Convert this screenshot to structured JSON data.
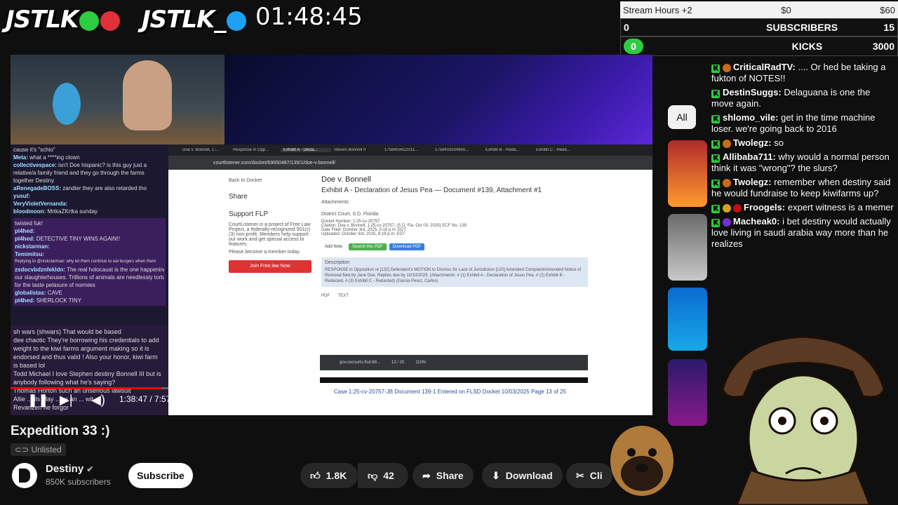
{
  "overlay": {
    "logo1": "JSTLK",
    "logo2": "JSTLK_",
    "timer": "01:48:45"
  },
  "goals": {
    "hours_label": "Stream Hours +2",
    "hours_min": "$0",
    "hours_max": "$60",
    "subs_current": "0",
    "subs_label": "SUBSCRIBERS",
    "subs_target": "15",
    "kicks_current": "0",
    "kicks_label": "KICKS",
    "kicks_target": "3000"
  },
  "embedded_chat": {
    "lines": [
      {
        "user": "",
        "text": "cause it's \"schio\""
      },
      {
        "user": "Meta:",
        "text": "what a ****ing clown"
      },
      {
        "user": "collectivespace:",
        "text": "isn't Doe hispanic? is this guy just a"
      },
      {
        "user": "",
        "text": "relative/a family friend and they go through the farms"
      },
      {
        "user": "",
        "text": "together Destiny"
      },
      {
        "user": "aRenegadeBOSS:",
        "text": "zandier they are also retarded tho"
      },
      {
        "user": "yusuf:",
        "text": ""
      },
      {
        "user": "VeryVioletVernanda:",
        "text": ""
      },
      {
        "user": "bloodmoon:",
        "text": "MrtkaZKrtka sunday"
      },
      {
        "user": "",
        "text": "twisted fuk!"
      },
      {
        "user": "pl4hed:",
        "text": ""
      },
      {
        "user": "pl4hed:",
        "text": "DETECTIVE TINY WINS AGAIN!!"
      },
      {
        "user": "nickstarman:",
        "text": ""
      },
      {
        "user": "Temimitsu:",
        "text": ""
      },
      {
        "user": "",
        "text": "Replying to @nickstarman: why let them continue to eat burgers when them"
      },
      {
        "user": "zsdocvbdznfekldn:",
        "text": "The real holocaust is the one happening in"
      },
      {
        "user": "",
        "text": "our slaughterhouses. Trillions of animals are needlessly torture"
      },
      {
        "user": "",
        "text": "for the taste pelasure of normies"
      },
      {
        "user": "globalistas:",
        "text": "CAVE"
      },
      {
        "user": "pl4hed:",
        "text": "SHERLOCK TINY"
      }
    ],
    "bottom": [
      "sh wars (shwars) That would be based",
      "dee chaotic They're borrowing his credentials to add",
      "weight to the kiwi farms argument making so it is",
      "endorsed and thus valid ! Also your honor, kiwi farm",
      "is based lol",
      "Todd Michael I love Stephen destiny Bonnell III but is",
      "anybody following what he's saying?",
      "Thomas Horton such an unserious lawsuit",
      "Allie ... ils May ... re an ... wit",
      "Revanzen he forgor"
    ]
  },
  "browser": {
    "tabs": [
      "Doe v. Bonnell, 1:...",
      "Response in Opp...",
      "Exhibit A - Decla...",
      "Steven Bonnell II",
      "1758403422011...",
      "1758403504850...",
      "Exhibit B - Reda...",
      "Exhibit C - Reda..."
    ],
    "url": "courtlistener.com/docket/69650487/139/1/doe-v-bonnell/",
    "back": "Back to Docket",
    "share": "Share",
    "support": "Support FLP",
    "support_text": "CourtListener is a project of Free Law Project, a federally-recognized 501(c)(3) non-profit. Members help support our work and get special access to features.",
    "please": "Please become a member today.",
    "join": "Join Free.law Now",
    "case_title": "Doe v. Bonnell",
    "exhibit_title": "Exhibit A - Declaration of Jesus Pea — Document #139, Attachment #1",
    "attachments": "Attachments",
    "court": "District Court, S.D. Florida",
    "docket_number": "Docket Number: 1:25-cv-20757",
    "citation": "Citation: Doe v. Bonnell, 1:25-cv-20757, (S.D. Fla. Oct 03, 2025) ECF No. 139",
    "date_filed": "Date Filed: October 3rd, 2025, 3:18 p.m. EDT",
    "uploaded": "Uploaded: October 3rd, 2025, 6:19 p.m. EDT",
    "add_note": "Add Note",
    "search_pdf": "Search this PDF",
    "download_pdf": "Download PDF",
    "description_label": "Description",
    "description": "RESPONSE in Opposition re [132] Defendant's MOTION to Dismiss for Lack of Jurisdiction [120] Amended Complaint/Amended Notice of Removal filed by Jane Doe. Replies due by 10/10/2025. (Attachments: # (1) Exhibit A - Declaration of Jesus Pea, # (2) Exhibit B - Redacted, # (3) Exhibit C - Redacted) (Garcia Perez, Carlos)",
    "pdf_tab": "PDF",
    "text_tab": "TEXT",
    "pdf_file": "gov.uscourts.flsd.68...",
    "pdf_page": "13 / 25",
    "pdf_zoom": "110%",
    "pdf_header": "Case 1:25-cv-20757-JB   Document 139-1   Entered on FLSD Docket 10/03/2025   Page 13 of 25"
  },
  "player": {
    "time": "1:38:47 / 7:57:45",
    "progress": 0.235
  },
  "video": {
    "title": "Expedition 33 :)",
    "visibility": "Unlisted",
    "channel": "Destiny",
    "subscribers": "850K subscribers",
    "subscribe": "Subscribe",
    "likes": "1.8K",
    "dislikes": "42",
    "share": "Share",
    "download": "Download",
    "clip": "Cli"
  },
  "sidebar": {
    "chip_all": "All"
  },
  "chat": [
    {
      "user": "CriticalRadTV:",
      "text": ".... Or hed be taking a fukton of NOTES!!"
    },
    {
      "user": "DestinSuggs:",
      "text": "Delaguana is one the move again."
    },
    {
      "user": "shlomo_vile:",
      "text": "get in the time machine loser. we're going back to 2016"
    },
    {
      "user": "Twolegz:",
      "text": "so"
    },
    {
      "user": "Allibaba711:",
      "text": "why would a normal person think it was \"wrong\"? the slurs?"
    },
    {
      "user": "Twolegz:",
      "text": "remember when destiny said he would fundraise to keep kiwifarms up?"
    },
    {
      "user": "Froogels:",
      "text": "expert witness is a memer"
    },
    {
      "user": "Macheak0:",
      "text": "i bet destiny would actually love living in saudi arabia way more than he realizes"
    }
  ],
  "colors": {
    "accent_red": "#ff0000",
    "kick_green": "#2ecc40",
    "bg": "#0f0f0f"
  }
}
